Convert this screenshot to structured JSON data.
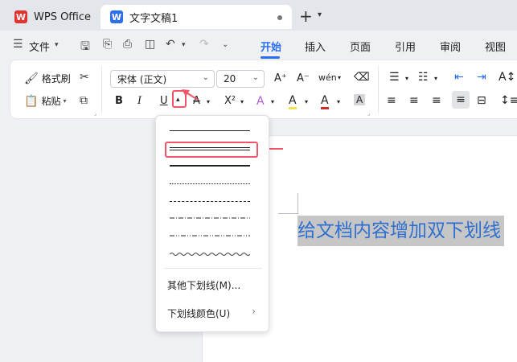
{
  "titlebar": {
    "app_tab": "WPS Office",
    "app_logo": "W",
    "doc_tab": "文字文稿1",
    "doc_logo": "W",
    "new_tab": "+"
  },
  "menubar": {
    "file": "文件",
    "tabs": [
      "开始",
      "插入",
      "页面",
      "引用",
      "审阅",
      "视图"
    ],
    "active_tab": "开始"
  },
  "ribbon": {
    "format_painter": "格式刷",
    "paste": "粘贴",
    "font_name": "宋体 (正文)",
    "font_size": "20",
    "bold": "B",
    "italic": "I",
    "underline": "U",
    "strikethrough": "A",
    "superscript": "X²",
    "text_effect": "A",
    "highlight": "A",
    "font_color": "A",
    "char_shading": "A",
    "grow_font": "A⁺",
    "shrink_font": "A⁻",
    "phonetic": "wén",
    "clear_format": "⌫"
  },
  "dropdown": {
    "more_underlines": "其他下划线(M)...",
    "underline_color": "下划线颜色(U)",
    "chevron": "›"
  },
  "document": {
    "text": "给文档内容增加双下划线"
  },
  "colors": {
    "accent": "#2b6ef0",
    "highlight": "#f0556a",
    "doc_text": "#2f6fd0",
    "selection": "#c6c6c6"
  }
}
